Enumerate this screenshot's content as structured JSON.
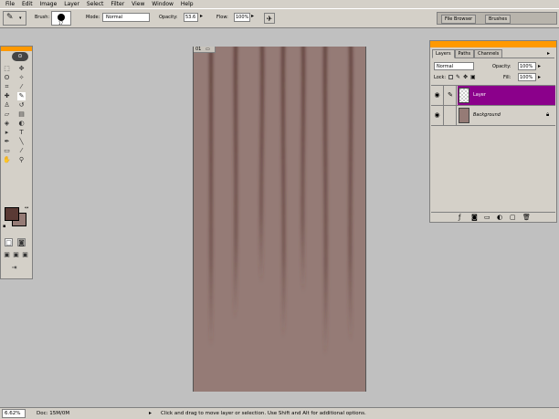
{
  "menu": [
    "File",
    "Edit",
    "Image",
    "Layer",
    "Select",
    "Filter",
    "View",
    "Window",
    "Help"
  ],
  "options": {
    "brush_label": "Brush:",
    "brush_size": "17",
    "mode_label": "Mode:",
    "mode_value": "Normal",
    "opacity_label": "Opacity:",
    "opacity_value": "53.6",
    "flow_label": "Flow:",
    "flow_value": "100%"
  },
  "palette_well": {
    "tabs": [
      "File Browser",
      "Brushes"
    ]
  },
  "document": {
    "tab_label": "01"
  },
  "layers_panel": {
    "tabs": [
      "Layers",
      "Paths",
      "Channels"
    ],
    "blend_mode": "Normal",
    "opacity_label": "Opacity:",
    "opacity_value": "100%",
    "lock_label": "Lock:",
    "fill_label": "Fill:",
    "fill_value": "100%",
    "layers": [
      {
        "name": "Layer",
        "selected": true,
        "color": "#8b008b"
      },
      {
        "name": "Background",
        "selected": false,
        "color": "#957b76"
      }
    ]
  },
  "colors": {
    "foreground": "#5a3a35",
    "background_swatch": "#957b76",
    "canvas": "#957b76",
    "selected_layer": "#8b008b",
    "title_accent": "#ff9900"
  },
  "status": {
    "zoom": "6.62%",
    "doc_label": "Doc: 15M/0M",
    "hint": "Click and drag to move layer or selection.  Use Shift and Alt for additional options."
  }
}
